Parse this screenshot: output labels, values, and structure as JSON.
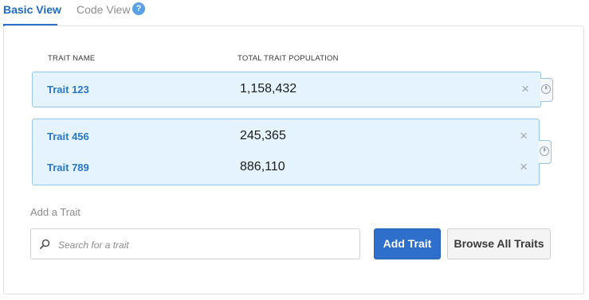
{
  "tabs": [
    {
      "label": "Basic View",
      "active": true
    },
    {
      "label": "Code View",
      "active": false
    }
  ],
  "help_icon": "?",
  "columns": {
    "name": "TRAIT NAME",
    "population": "TOTAL TRAIT POPULATION"
  },
  "groups": [
    {
      "traits": [
        {
          "name": "Trait 123",
          "population": "1,158,432"
        }
      ]
    },
    {
      "traits": [
        {
          "name": "Trait 456",
          "population": "245,365"
        },
        {
          "name": "Trait 789",
          "population": "886,110"
        }
      ]
    }
  ],
  "remove_glyph": "×",
  "add_trait": {
    "label": "Add a Trait",
    "search_placeholder": "Search for a trait",
    "add_button": "Add Trait",
    "browse_button": "Browse All Traits"
  },
  "colors": {
    "accent": "#2d6fcb",
    "group_bg": "#e4f3fd",
    "group_border": "#99c6ec"
  }
}
